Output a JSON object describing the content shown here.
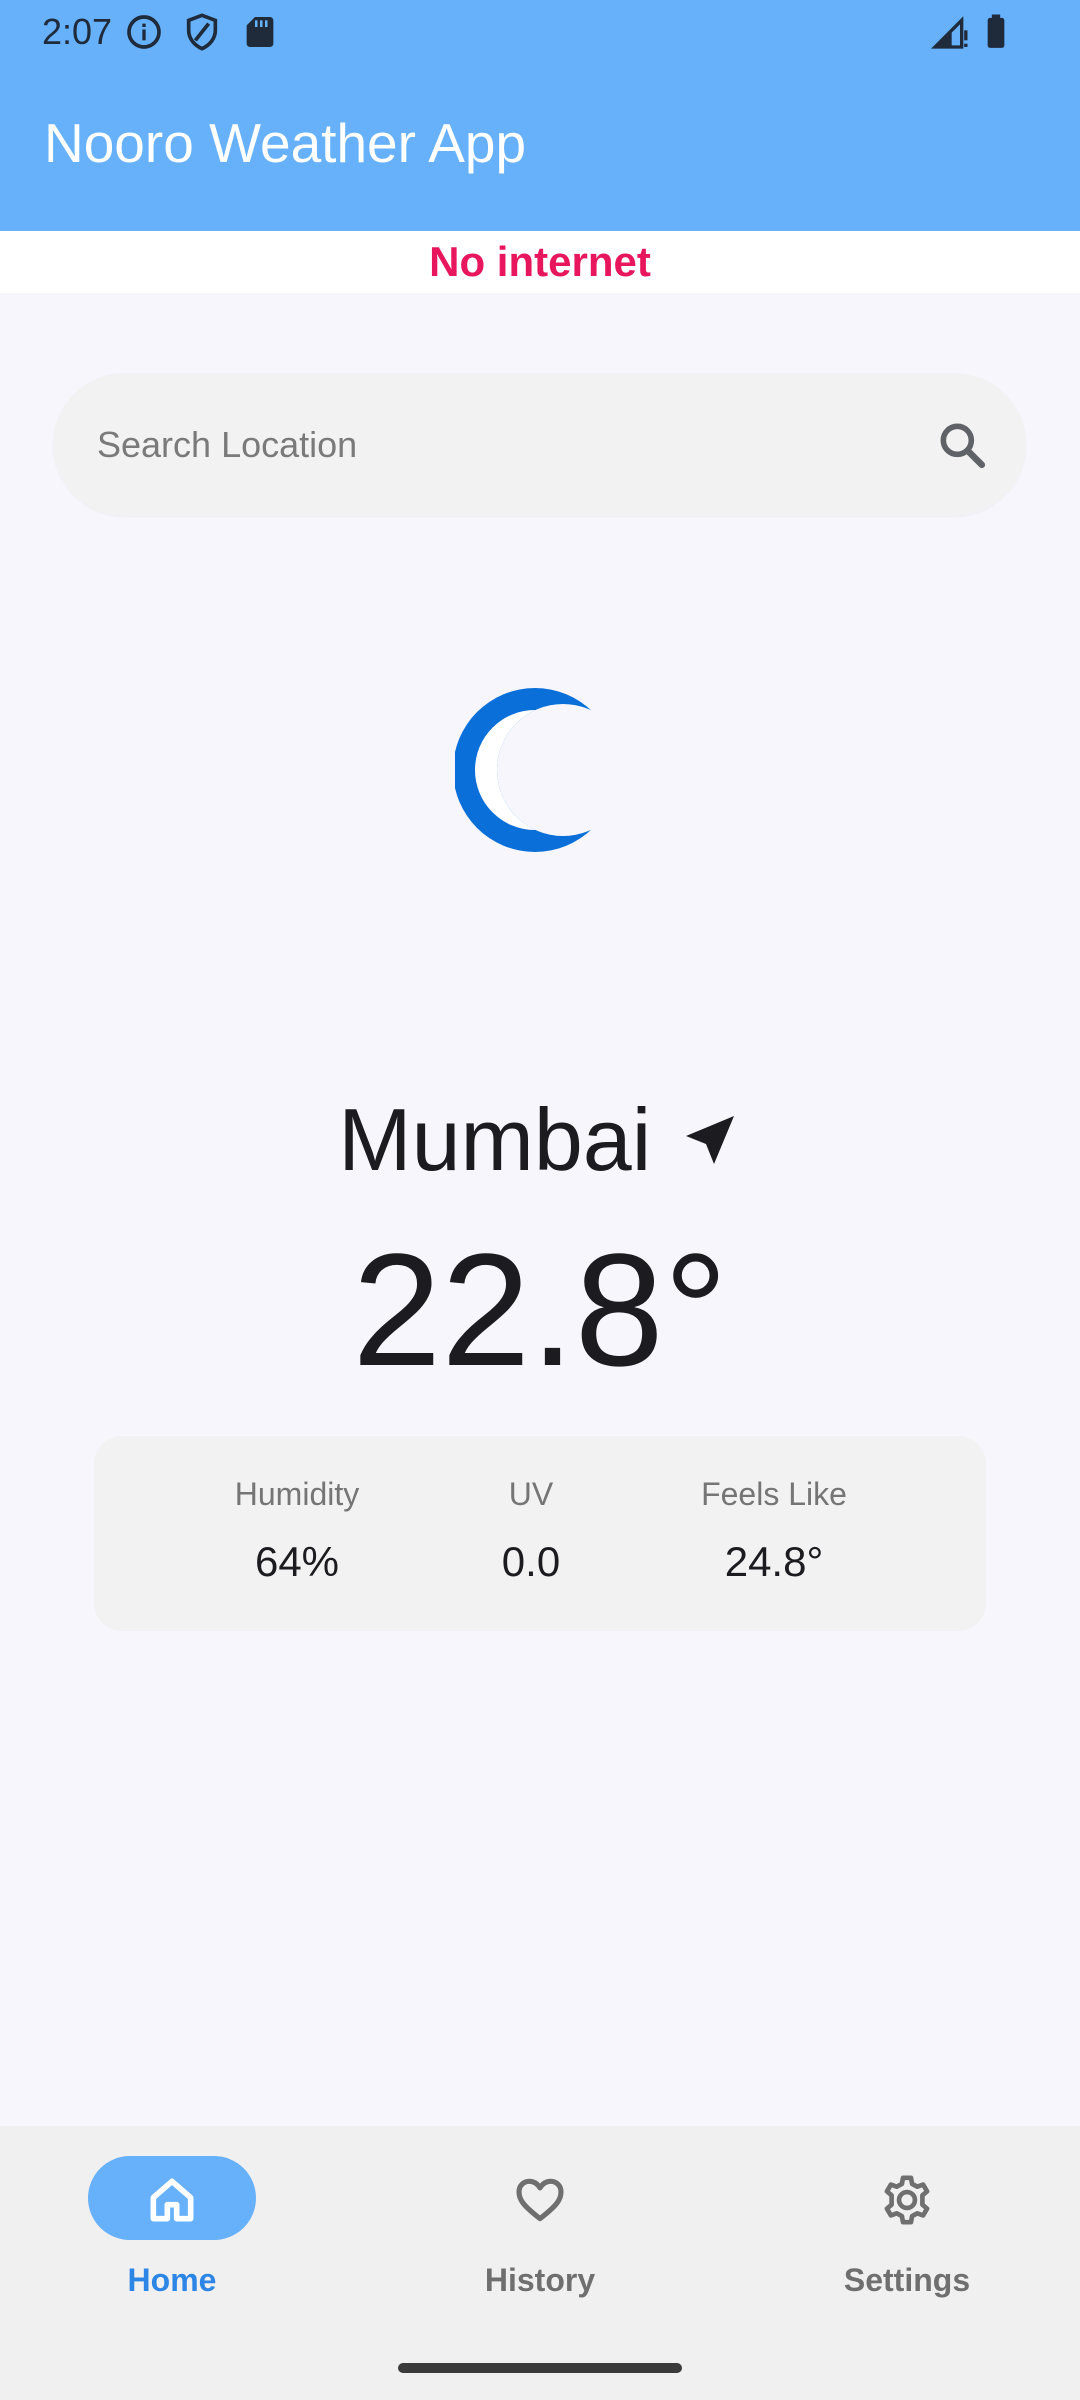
{
  "status_bar": {
    "time": "2:07"
  },
  "app_bar": {
    "title": "Nooro Weather App"
  },
  "banner": {
    "text": "No internet",
    "color": "#e8175d"
  },
  "search": {
    "placeholder": "Search Location",
    "value": ""
  },
  "weather": {
    "condition_icon": "crescent-moon-icon",
    "city": "Mumbai",
    "temperature": "22.8°"
  },
  "stats": [
    {
      "label": "Humidity",
      "value": "64%"
    },
    {
      "label": "UV",
      "value": "0.0"
    },
    {
      "label": "Feels Like",
      "value": "24.8°"
    }
  ],
  "nav": {
    "items": [
      {
        "label": "Home",
        "icon": "home-icon",
        "active": true
      },
      {
        "label": "History",
        "icon": "heart-icon",
        "active": false
      },
      {
        "label": "Settings",
        "icon": "gear-icon",
        "active": false
      }
    ]
  },
  "colors": {
    "primary": "#66b1fa",
    "accent_text": "#2d86e6",
    "background": "#f7f6fc",
    "surface": "#f2f2f2"
  }
}
